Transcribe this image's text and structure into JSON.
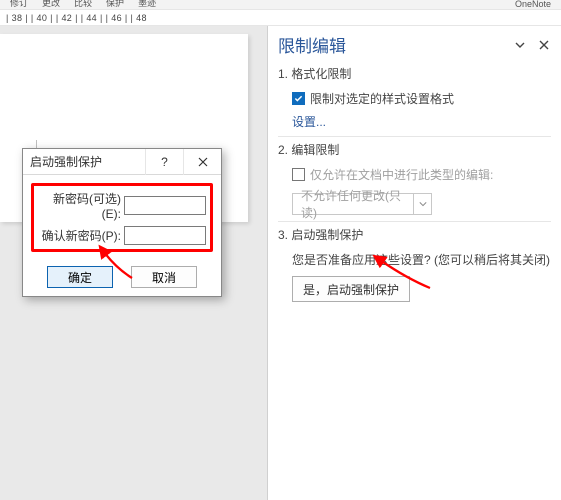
{
  "top_tabs": [
    "修订",
    "更改",
    "比较",
    "保护",
    "墨迹",
    "OneNote"
  ],
  "ruler_marks": [
    "|",
    "38",
    "|",
    "|",
    "40",
    "|",
    "|",
    "42",
    "|",
    "|",
    "44",
    "|",
    "|",
    "46",
    "|",
    "|",
    "48"
  ],
  "panel": {
    "title": "限制编辑",
    "section1": {
      "title": "1. 格式化限制",
      "checkbox_label": "限制对选定的样式设置格式",
      "settings_link": "设置..."
    },
    "section2": {
      "title": "2. 编辑限制",
      "checkbox_label": "仅允许在文档中进行此类型的编辑:",
      "dropdown_value": "不允许任何更改(只读)"
    },
    "section3": {
      "title": "3. 启动强制保护",
      "desc": "您是否准备应用这些设置? (您可以稍后将其关闭)",
      "button_label": "是，启动强制保护"
    }
  },
  "dialog": {
    "title": "启动强制保护",
    "help": "?",
    "row1_label": "新密码(可选)(E):",
    "row2_label": "确认新密码(P):",
    "ok": "确定",
    "cancel": "取消"
  }
}
